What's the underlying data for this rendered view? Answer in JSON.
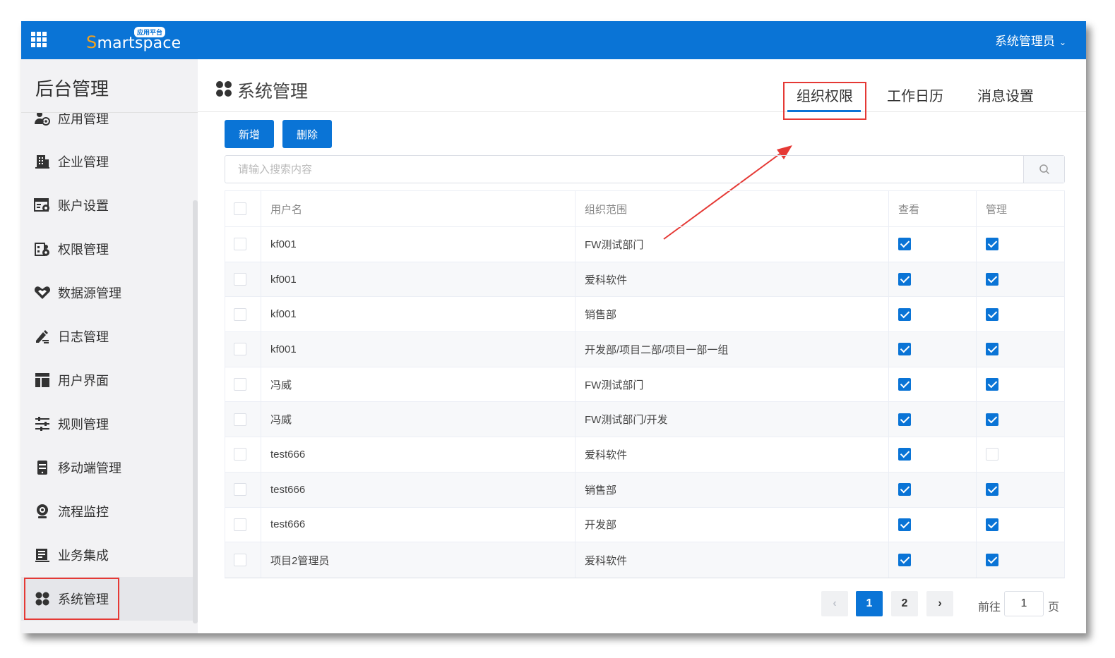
{
  "topbar": {
    "logo_initial": "S",
    "logo_rest": "martspace",
    "logo_badge": "应用平台",
    "user": "系统管理员",
    "user_chevron": "⌄"
  },
  "sidebar": {
    "title": "后台管理",
    "items": [
      {
        "label": "应用管理",
        "icon": "app-gear-icon"
      },
      {
        "label": "企业管理",
        "icon": "building-icon"
      },
      {
        "label": "账户设置",
        "icon": "account-settings-icon"
      },
      {
        "label": "权限管理",
        "icon": "permission-icon"
      },
      {
        "label": "数据源管理",
        "icon": "datasource-icon"
      },
      {
        "label": "日志管理",
        "icon": "log-pen-icon"
      },
      {
        "label": "用户界面",
        "icon": "layout-icon"
      },
      {
        "label": "规则管理",
        "icon": "rules-icon"
      },
      {
        "label": "移动端管理",
        "icon": "mobile-icon"
      },
      {
        "label": "流程监控",
        "icon": "camera-monitor-icon"
      },
      {
        "label": "业务集成",
        "icon": "integration-icon"
      },
      {
        "label": "系统管理",
        "icon": "four-dots-icon"
      }
    ],
    "active_index": 11
  },
  "main": {
    "title": "系统管理",
    "tabs": [
      "组织权限",
      "工作日历",
      "消息设置"
    ],
    "active_tab": 0,
    "buttons": {
      "add": "新增",
      "delete": "删除"
    },
    "search": {
      "placeholder": "请输入搜索内容",
      "value": ""
    },
    "table": {
      "columns": [
        "用户名",
        "组织范围",
        "查看",
        "管理"
      ],
      "rows": [
        {
          "user": "kf001",
          "scope": "FW测试部门",
          "view": true,
          "manage": true
        },
        {
          "user": "kf001",
          "scope": "爱科软件",
          "view": true,
          "manage": true
        },
        {
          "user": "kf001",
          "scope": "销售部",
          "view": true,
          "manage": true
        },
        {
          "user": "kf001",
          "scope": "开发部/项目二部/项目一部一组",
          "view": true,
          "manage": true
        },
        {
          "user": "冯威",
          "scope": "FW测试部门",
          "view": true,
          "manage": true
        },
        {
          "user": "冯威",
          "scope": "FW测试部门/开发",
          "view": true,
          "manage": true
        },
        {
          "user": "test666",
          "scope": "爱科软件",
          "view": true,
          "manage": false
        },
        {
          "user": "test666",
          "scope": "销售部",
          "view": true,
          "manage": true
        },
        {
          "user": "test666",
          "scope": "开发部",
          "view": true,
          "manage": true
        },
        {
          "user": "项目2管理员",
          "scope": "爱科软件",
          "view": true,
          "manage": true
        }
      ]
    },
    "pagination": {
      "prev": "‹",
      "pages": [
        "1",
        "2"
      ],
      "current": "1",
      "next": "›",
      "goto_prefix": "前往",
      "goto_value": "1",
      "goto_suffix": "页"
    }
  },
  "colors": {
    "primary": "#0a74d6",
    "highlight": "#e53935",
    "logo_accent": "#f5a21c"
  }
}
